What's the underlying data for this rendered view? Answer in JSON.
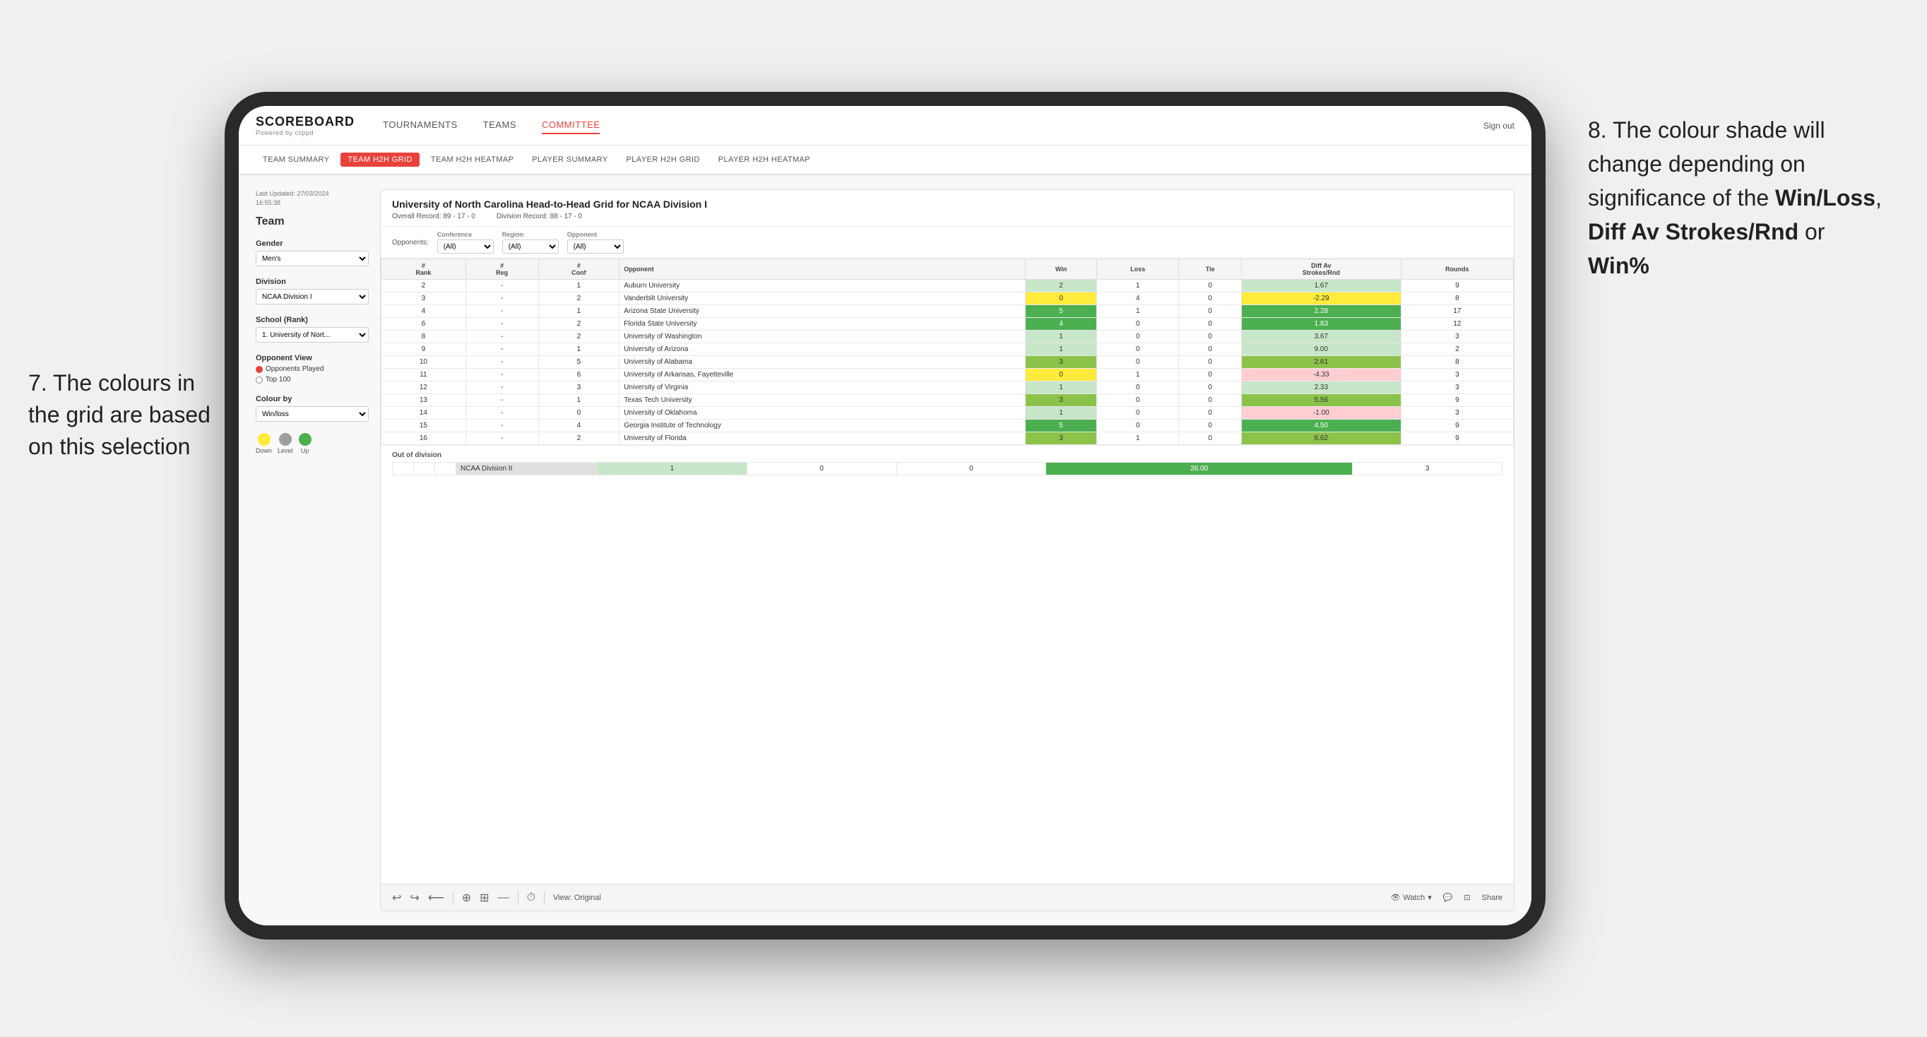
{
  "annotations": {
    "left_text": "7. The colours in the grid are based on this selection",
    "right_text_prefix": "8. The colour shade will change depending on significance of the ",
    "right_bold1": "Win/Loss",
    "right_comma": ", ",
    "right_bold2": "Diff Av Strokes/Rnd",
    "right_or": " or ",
    "right_bold3": "Win%"
  },
  "nav": {
    "logo": "SCOREBOARD",
    "logo_sub": "Powered by clippd",
    "items": [
      "TOURNAMENTS",
      "TEAMS",
      "COMMITTEE"
    ],
    "sign_out": "Sign out",
    "active_item": "COMMITTEE"
  },
  "sub_nav": {
    "items": [
      "TEAM SUMMARY",
      "TEAM H2H GRID",
      "TEAM H2H HEATMAP",
      "PLAYER SUMMARY",
      "PLAYER H2H GRID",
      "PLAYER H2H HEATMAP"
    ],
    "active": "TEAM H2H GRID"
  },
  "left_panel": {
    "last_updated_label": "Last Updated: 27/03/2024",
    "last_updated_time": "16:55:38",
    "team_label": "Team",
    "gender_label": "Gender",
    "gender_value": "Men's",
    "division_label": "Division",
    "division_value": "NCAA Division I",
    "school_label": "School (Rank)",
    "school_value": "1. University of Nort...",
    "opponent_view_label": "Opponent View",
    "radio1": "Opponents Played",
    "radio2": "Top 100",
    "colour_by_label": "Colour by",
    "colour_by_value": "Win/loss"
  },
  "legend": {
    "down_label": "Down",
    "level_label": "Level",
    "up_label": "Up",
    "down_color": "#ffeb3b",
    "level_color": "#9e9e9e",
    "up_color": "#4caf50"
  },
  "grid": {
    "title": "University of North Carolina Head-to-Head Grid for NCAA Division I",
    "overall_record_label": "Overall Record:",
    "overall_record_value": "89 - 17 - 0",
    "division_record_label": "Division Record:",
    "division_record_value": "88 - 17 - 0",
    "filters": {
      "conference_label": "Conference",
      "conference_value": "(All)",
      "region_label": "Region",
      "region_value": "(All)",
      "opponent_label": "Opponent",
      "opponent_value": "(All)",
      "opponents_label": "Opponents:"
    },
    "table_headers": [
      "# Rank",
      "# Reg",
      "# Conf",
      "Opponent",
      "Win",
      "Loss",
      "Tie",
      "Diff Av Strokes/Rnd",
      "Rounds"
    ],
    "rows": [
      {
        "rank": "2",
        "reg": "-",
        "conf": "1",
        "opponent": "Auburn University",
        "win": "2",
        "loss": "1",
        "tie": "0",
        "diff": "1.67",
        "rounds": "9",
        "win_color": "cell-green-light",
        "diff_color": "cell-green-light"
      },
      {
        "rank": "3",
        "reg": "-",
        "conf": "2",
        "opponent": "Vanderbilt University",
        "win": "0",
        "loss": "4",
        "tie": "0",
        "diff": "-2.29",
        "rounds": "8",
        "win_color": "cell-yellow",
        "diff_color": "cell-yellow"
      },
      {
        "rank": "4",
        "reg": "-",
        "conf": "1",
        "opponent": "Arizona State University",
        "win": "5",
        "loss": "1",
        "tie": "0",
        "diff": "2.28",
        "rounds": "17",
        "win_color": "cell-green-dark",
        "diff_color": "cell-green-dark"
      },
      {
        "rank": "6",
        "reg": "-",
        "conf": "2",
        "opponent": "Florida State University",
        "win": "4",
        "loss": "0",
        "tie": "0",
        "diff": "1.83",
        "rounds": "12",
        "win_color": "cell-green-dark",
        "diff_color": "cell-green-dark"
      },
      {
        "rank": "8",
        "reg": "-",
        "conf": "2",
        "opponent": "University of Washington",
        "win": "1",
        "loss": "0",
        "tie": "0",
        "diff": "3.67",
        "rounds": "3",
        "win_color": "cell-green-light",
        "diff_color": "cell-green-light"
      },
      {
        "rank": "9",
        "reg": "-",
        "conf": "1",
        "opponent": "University of Arizona",
        "win": "1",
        "loss": "0",
        "tie": "0",
        "diff": "9.00",
        "rounds": "2",
        "win_color": "cell-green-light",
        "diff_color": "cell-green-light"
      },
      {
        "rank": "10",
        "reg": "-",
        "conf": "5",
        "opponent": "University of Alabama",
        "win": "3",
        "loss": "0",
        "tie": "0",
        "diff": "2.61",
        "rounds": "8",
        "win_color": "cell-green-mid",
        "diff_color": "cell-green-mid"
      },
      {
        "rank": "11",
        "reg": "-",
        "conf": "6",
        "opponent": "University of Arkansas, Fayetteville",
        "win": "0",
        "loss": "1",
        "tie": "0",
        "diff": "-4.33",
        "rounds": "3",
        "win_color": "cell-yellow",
        "diff_color": "cell-red-light"
      },
      {
        "rank": "12",
        "reg": "-",
        "conf": "3",
        "opponent": "University of Virginia",
        "win": "1",
        "loss": "0",
        "tie": "0",
        "diff": "2.33",
        "rounds": "3",
        "win_color": "cell-green-light",
        "diff_color": "cell-green-light"
      },
      {
        "rank": "13",
        "reg": "-",
        "conf": "1",
        "opponent": "Texas Tech University",
        "win": "3",
        "loss": "0",
        "tie": "0",
        "diff": "5.56",
        "rounds": "9",
        "win_color": "cell-green-mid",
        "diff_color": "cell-green-mid"
      },
      {
        "rank": "14",
        "reg": "-",
        "conf": "0",
        "opponent": "University of Oklahoma",
        "win": "1",
        "loss": "0",
        "tie": "0",
        "diff": "-1.00",
        "rounds": "3",
        "win_color": "cell-green-light",
        "diff_color": "cell-red-light"
      },
      {
        "rank": "15",
        "reg": "-",
        "conf": "4",
        "opponent": "Georgia Institute of Technology",
        "win": "5",
        "loss": "0",
        "tie": "0",
        "diff": "4.50",
        "rounds": "9",
        "win_color": "cell-green-dark",
        "diff_color": "cell-green-dark"
      },
      {
        "rank": "16",
        "reg": "-",
        "conf": "2",
        "opponent": "University of Florida",
        "win": "3",
        "loss": "1",
        "tie": "0",
        "diff": "6.62",
        "rounds": "9",
        "win_color": "cell-green-mid",
        "diff_color": "cell-green-mid"
      }
    ],
    "out_of_division": {
      "label": "Out of division",
      "row": {
        "division": "NCAA Division II",
        "win": "1",
        "loss": "0",
        "tie": "0",
        "diff": "26.00",
        "rounds": "3",
        "win_color": "cell-green-light",
        "diff_color": "cell-green-dark"
      }
    }
  },
  "toolbar": {
    "view_label": "View: Original",
    "watch_label": "Watch",
    "share_label": "Share"
  }
}
